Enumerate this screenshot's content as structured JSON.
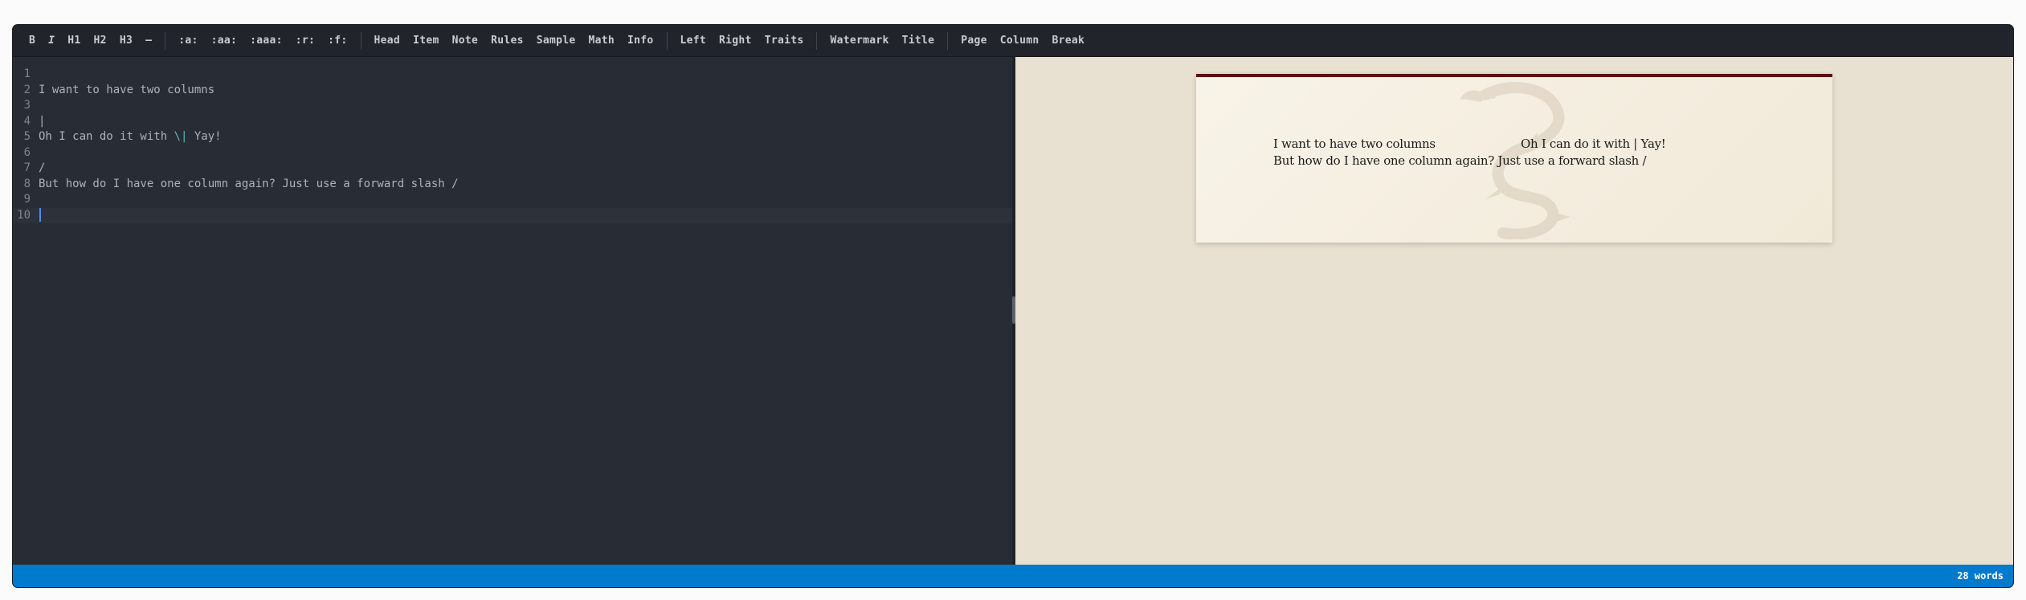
{
  "toolbar": {
    "groups": [
      [
        "B",
        "I",
        "H1",
        "H2",
        "H3",
        "—"
      ],
      [
        ":a:",
        ":aa:",
        ":aaa:",
        ":r:",
        ":f:"
      ],
      [
        "Head",
        "Item",
        "Note",
        "Rules",
        "Sample",
        "Math",
        "Info"
      ],
      [
        "Left",
        "Right",
        "Traits"
      ],
      [
        "Watermark",
        "Title"
      ],
      [
        "Page",
        "Column",
        "Break"
      ]
    ]
  },
  "editor": {
    "lines": [
      {
        "num": "1",
        "text": ""
      },
      {
        "num": "2",
        "text": "I want to have two columns"
      },
      {
        "num": "3",
        "text": ""
      },
      {
        "num": "4",
        "text": "|"
      },
      {
        "num": "5",
        "text_before": "Oh I can do it with ",
        "highlight": "\\|",
        "text_after": " Yay!"
      },
      {
        "num": "6",
        "text": ""
      },
      {
        "num": "7",
        "text": "/"
      },
      {
        "num": "8",
        "text": "But how do I have one column again? Just use a forward slash /"
      },
      {
        "num": "9",
        "text": ""
      },
      {
        "num": "10",
        "text": ""
      }
    ]
  },
  "preview": {
    "col1": "I want to have two columns",
    "col2": "Oh I can do it with | Yay!",
    "full": "But how do I have one column again? Just use a forward slash /"
  },
  "status": {
    "word_count": "28 words"
  },
  "colors": {
    "status_bar": "#007acc",
    "page_top_rule": "#5c1111",
    "editor_bg": "#282c34"
  }
}
